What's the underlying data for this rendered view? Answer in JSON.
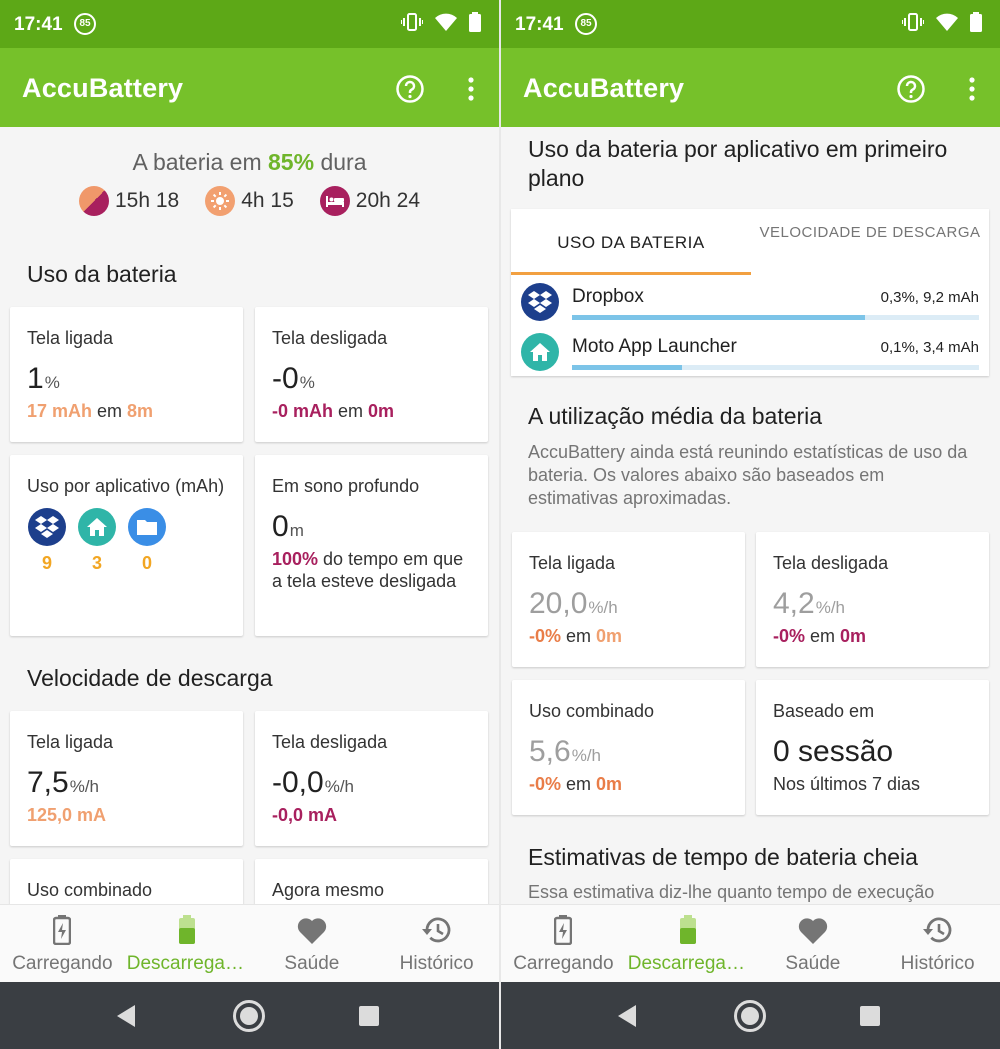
{
  "status": {
    "time": "17:41",
    "badge": "85"
  },
  "app": {
    "title": "AccuBattery"
  },
  "nav": {
    "items": [
      {
        "label": "Carregando",
        "icon": "battery-charging-icon"
      },
      {
        "label": "Descarregan...",
        "icon": "battery-discharging-icon"
      },
      {
        "label": "Saúde",
        "icon": "heart-icon"
      },
      {
        "label": "Histórico",
        "icon": "history-icon"
      }
    ],
    "active_color": "#6fb52b"
  },
  "left": {
    "hero": {
      "prefix": "A bateria em ",
      "percent": "85%",
      "suffix": " dura",
      "screen_on": "15h 18",
      "brightness": "4h 15",
      "sleep": "20h 24"
    },
    "battery_usage": {
      "title": "Uso da bateria",
      "screen_on": {
        "label": "Tela ligada",
        "value": "1",
        "unit": "%",
        "sub_a": "17 mAh",
        "sub_mid": " em ",
        "sub_b": "8m"
      },
      "screen_off": {
        "label": "Tela desligada",
        "value": "-0",
        "unit": "%",
        "sub_a": "-0 mAh",
        "sub_mid": " em ",
        "sub_b": "0m"
      },
      "per_app": {
        "label": "Uso por aplicativo (mAh)",
        "apps": [
          {
            "icon": "dropbox-icon",
            "value": "9"
          },
          {
            "icon": "home-icon",
            "value": "3"
          },
          {
            "icon": "folder-icon",
            "value": "0"
          }
        ]
      },
      "deep_sleep": {
        "label": "Em sono profundo",
        "value": "0",
        "unit": "m",
        "sub_a": "100%",
        "sub_rest": " do tempo em que a tela esteve desligada"
      }
    },
    "discharge_speed": {
      "title": "Velocidade de descarga",
      "screen_on": {
        "label": "Tela ligada",
        "value": "7,5",
        "unit": "%/h",
        "sub": "125,0 mA"
      },
      "screen_off": {
        "label": "Tela desligada",
        "value": "-0,0",
        "unit": "%/h",
        "sub": "-0,0 mA"
      },
      "combined": {
        "label": "Uso combinado"
      },
      "right_now": {
        "label": "Agora mesmo"
      }
    }
  },
  "right": {
    "foreground": {
      "title": "Uso da bateria por aplicativo em primeiro plano",
      "tabs": [
        "USO DA BATERIA",
        "VELOCIDADE DE DESCARGA"
      ],
      "apps": [
        {
          "name": "Dropbox",
          "value": "0,3%, 9,2 mAh",
          "bar": 0.72
        },
        {
          "name": "Moto App Launcher",
          "value": "0,1%, 3,4 mAh",
          "bar": 0.27
        }
      ]
    },
    "average": {
      "title": "A utilização média da bateria",
      "desc": "AccuBattery ainda está reunindo estatísticas de uso da bateria. Os valores abaixo são baseados em estimativas aproximadas.",
      "screen_on": {
        "label": "Tela ligada",
        "value": "20,0",
        "unit": "%/h",
        "sub_a": "-0%",
        "sub_mid": " em ",
        "sub_b": "0m"
      },
      "screen_off": {
        "label": "Tela desligada",
        "value": "4,2",
        "unit": "%/h",
        "sub_a": "-0%",
        "sub_mid": " em ",
        "sub_b": "0m"
      },
      "combined": {
        "label": "Uso combinado",
        "value": "5,6",
        "unit": "%/h",
        "sub_a": "-0%",
        "sub_mid": " em ",
        "sub_b": "0m"
      },
      "based_on": {
        "label": "Baseado em",
        "value": "0 sessão",
        "sub": "Nos últimos 7 dias"
      }
    },
    "estimates": {
      "title": "Estimativas de tempo de bateria cheia",
      "desc": "Essa estimativa diz-lhe quanto tempo de execução"
    }
  }
}
